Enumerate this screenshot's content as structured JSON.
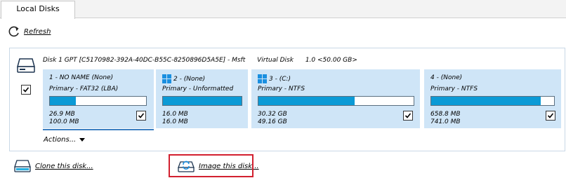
{
  "tabs": [
    {
      "label": "Local Disks"
    }
  ],
  "toolbar": {
    "refresh_label": "Refresh"
  },
  "disk": {
    "name": "Disk 1 GPT [C5170982-392A-40DC-B55C-8250896D5A5E] - Msft",
    "type": "Virtual Disk",
    "size": "1.0  <50.00 GB>",
    "checked": true,
    "partitions": [
      {
        "title": "1 - NO NAME (None)",
        "kind": "Primary - FAT32 (LBA)",
        "used": "26.9 MB",
        "total": "100.0 MB",
        "fill_fraction": 0.27,
        "windows_logo": false,
        "checked": true
      },
      {
        "title": "2 -  (None)",
        "kind": "Primary - Unformatted",
        "used": "16.0 MB",
        "total": "16.0 MB",
        "fill_fraction": 1.0,
        "windows_logo": true,
        "checked": true
      },
      {
        "title": "3 -  (C:)",
        "kind": "Primary - NTFS",
        "used": "30.32 GB",
        "total": "49.16 GB",
        "fill_fraction": 0.62,
        "windows_logo": true,
        "checked": true
      },
      {
        "title": "4 -  (None)",
        "kind": "Primary - NTFS",
        "used": "658.8 MB",
        "total": "741.0 MB",
        "fill_fraction": 0.89,
        "windows_logo": false,
        "checked": true
      }
    ],
    "actions_label": "Actions..."
  },
  "links": {
    "clone_label": "Clone this disk...",
    "image_label": "Image this disk..."
  },
  "colors": {
    "partition_bg": "#cfe5f7",
    "bar_fill": "#0b9ad6",
    "highlight": "#d2202f"
  },
  "icons": {
    "refresh": "refresh-icon",
    "disk": "hard-disk-icon",
    "windows": "windows-logo-icon",
    "clone": "clone-disk-icon",
    "image": "image-disk-icon"
  }
}
